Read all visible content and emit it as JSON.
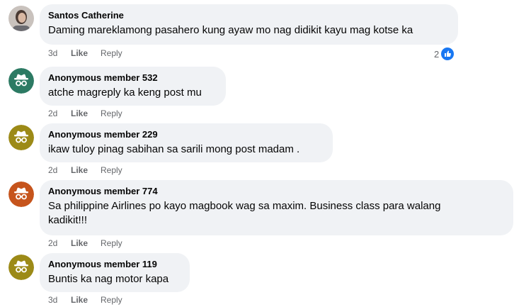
{
  "colors": {
    "bubble_bg": "#f0f2f5",
    "anon_green": "#2c7a63",
    "anon_olive": "#9c8a17",
    "anon_orange": "#c6541c",
    "link_blue": "#1877f2"
  },
  "comments": [
    {
      "author": "Santos Catherine",
      "text": "Daming mareklamong pasahero kung ayaw mo nag didikit kayu mag kotse ka",
      "time": "3d",
      "like": "Like",
      "reply": "Reply",
      "reaction_count": "2",
      "avatar": "profile-photo"
    },
    {
      "author": "Anonymous member 532",
      "text": "atche magreply ka keng post mu",
      "time": "2d",
      "like": "Like",
      "reply": "Reply",
      "avatar": "anonymous-icon"
    },
    {
      "author": "Anonymous member 229",
      "text": "ikaw tuloy pinag sabihan sa sarili mong post madam .",
      "time": "2d",
      "like": "Like",
      "reply": "Reply",
      "avatar": "anonymous-icon"
    },
    {
      "author": "Anonymous member 774",
      "text": "Sa philippine Airlines po kayo magbook wag sa maxim. Business class para walang kadikit!!!",
      "time": "2d",
      "like": "Like",
      "reply": "Reply",
      "avatar": "anonymous-icon"
    },
    {
      "author": "Anonymous member 119",
      "text": "Buntis ka nag motor kapa",
      "time": "3d",
      "like": "Like",
      "reply": "Reply",
      "avatar": "anonymous-icon"
    }
  ]
}
